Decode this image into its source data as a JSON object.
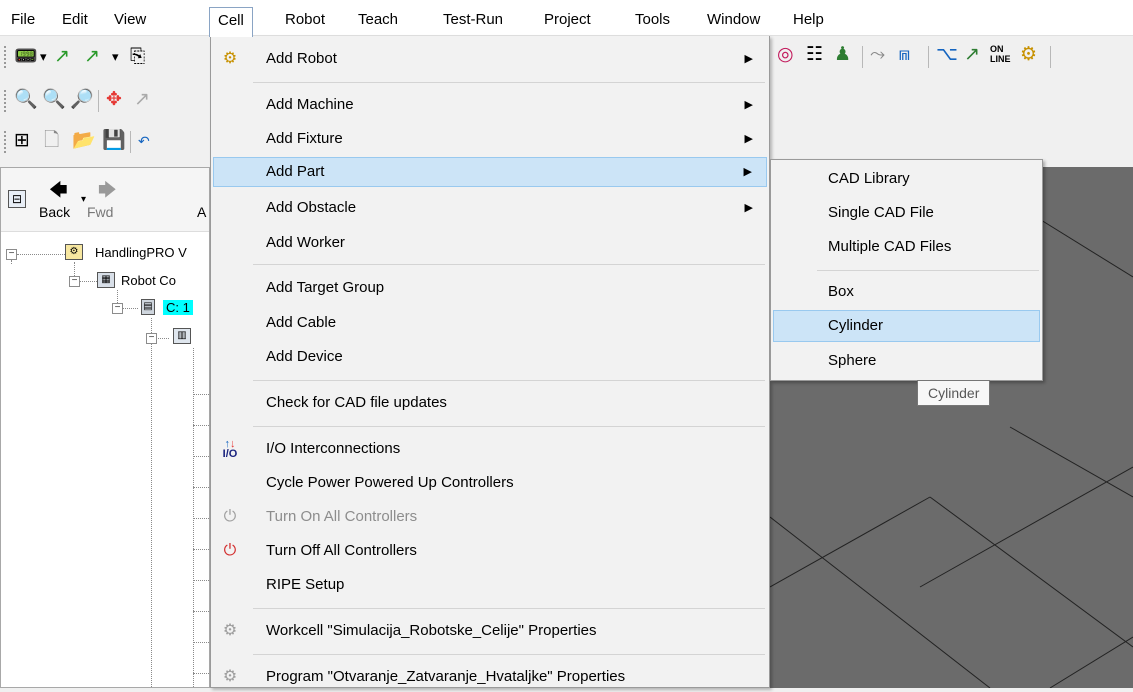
{
  "menubar": {
    "items": [
      "File",
      "Edit",
      "View",
      "Cell",
      "Robot",
      "Teach",
      "Test-Run",
      "Project",
      "Tools",
      "Window",
      "Help"
    ],
    "active": "Cell"
  },
  "nav": {
    "back": "Back",
    "fwd": "Fwd",
    "partial": "A"
  },
  "tree": {
    "root": "HandlingPRO V",
    "robot_controller": "Robot Co",
    "controller_item": "C: 1"
  },
  "cell_menu": {
    "items": [
      {
        "label": "Add Robot",
        "submenu": true
      },
      {
        "label": "Add Machine",
        "submenu": true
      },
      {
        "label": "Add Fixture",
        "submenu": true
      },
      {
        "label": "Add Part",
        "submenu": true,
        "highlighted": true
      },
      {
        "label": "Add Obstacle",
        "submenu": true
      },
      {
        "label": "Add Worker"
      },
      {
        "label": "Add Target Group"
      },
      {
        "label": "Add Cable"
      },
      {
        "label": "Add Device"
      },
      {
        "label": "Check for CAD file updates"
      },
      {
        "label": "I/O Interconnections",
        "icon": "io-icon"
      },
      {
        "label": "Cycle Power Powered Up Controllers"
      },
      {
        "label": "Turn On All Controllers",
        "disabled": true,
        "icon": "power-on-icon"
      },
      {
        "label": "Turn Off All Controllers",
        "icon": "power-off-icon"
      },
      {
        "label": "RIPE Setup"
      },
      {
        "label": "Workcell \"Simulacija_Robotske_Celije\" Properties",
        "icon": "gear-icon"
      },
      {
        "label": "Program \"Otvaranje_Zatvaranje_Hvataljke\" Properties",
        "icon": "gear-icon"
      }
    ]
  },
  "add_part_submenu": {
    "items": [
      "CAD Library",
      "Single CAD File",
      "Multiple CAD Files",
      "Box",
      "Cylinder",
      "Sphere"
    ],
    "highlighted": "Cylinder"
  },
  "tooltip": {
    "text": "Cylinder"
  },
  "toolbar": {
    "online_label": "ON LINE"
  },
  "colors": {
    "highlight_bg": "#cce4f7",
    "highlight_border": "#99c9ef",
    "viewport_bg": "#6b6b6b",
    "selected_tree_bg": "#00ffff"
  }
}
